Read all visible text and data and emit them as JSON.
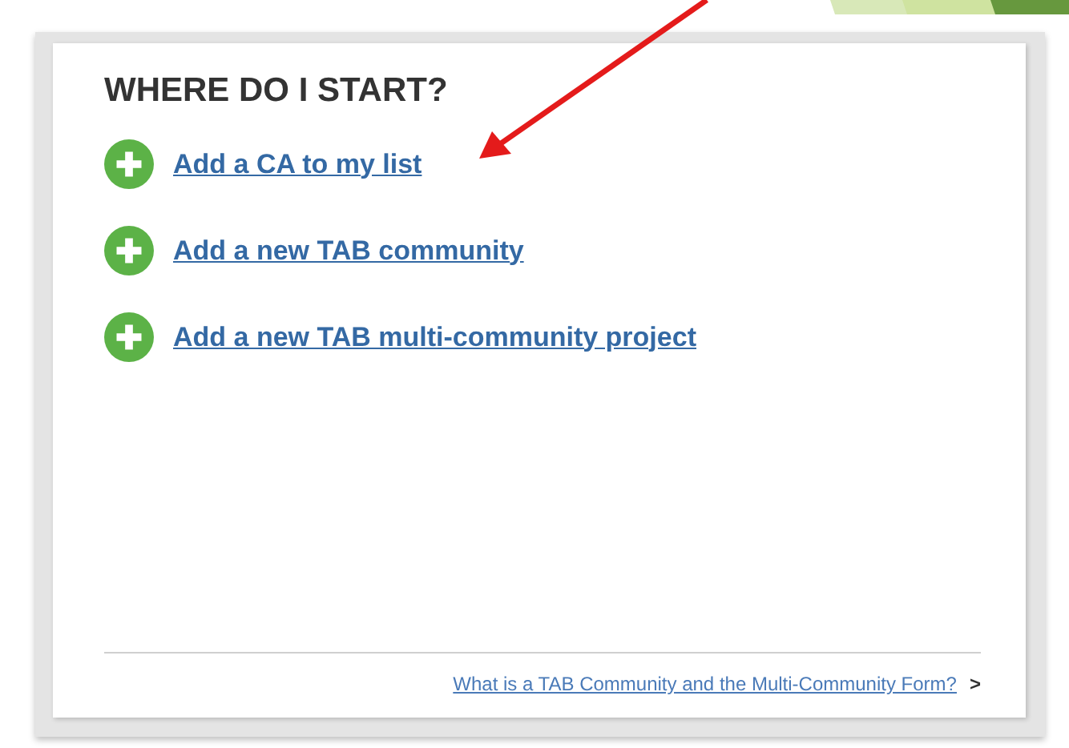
{
  "panel": {
    "title": "WHERE DO I START?",
    "actions": [
      {
        "label": "Add a CA to my list"
      },
      {
        "label": "Add a new TAB community"
      },
      {
        "label": "Add a new TAB multi-community project"
      }
    ],
    "footer": {
      "link": "What is a TAB Community and the Multi-Community Form?",
      "chevron": ">"
    }
  }
}
